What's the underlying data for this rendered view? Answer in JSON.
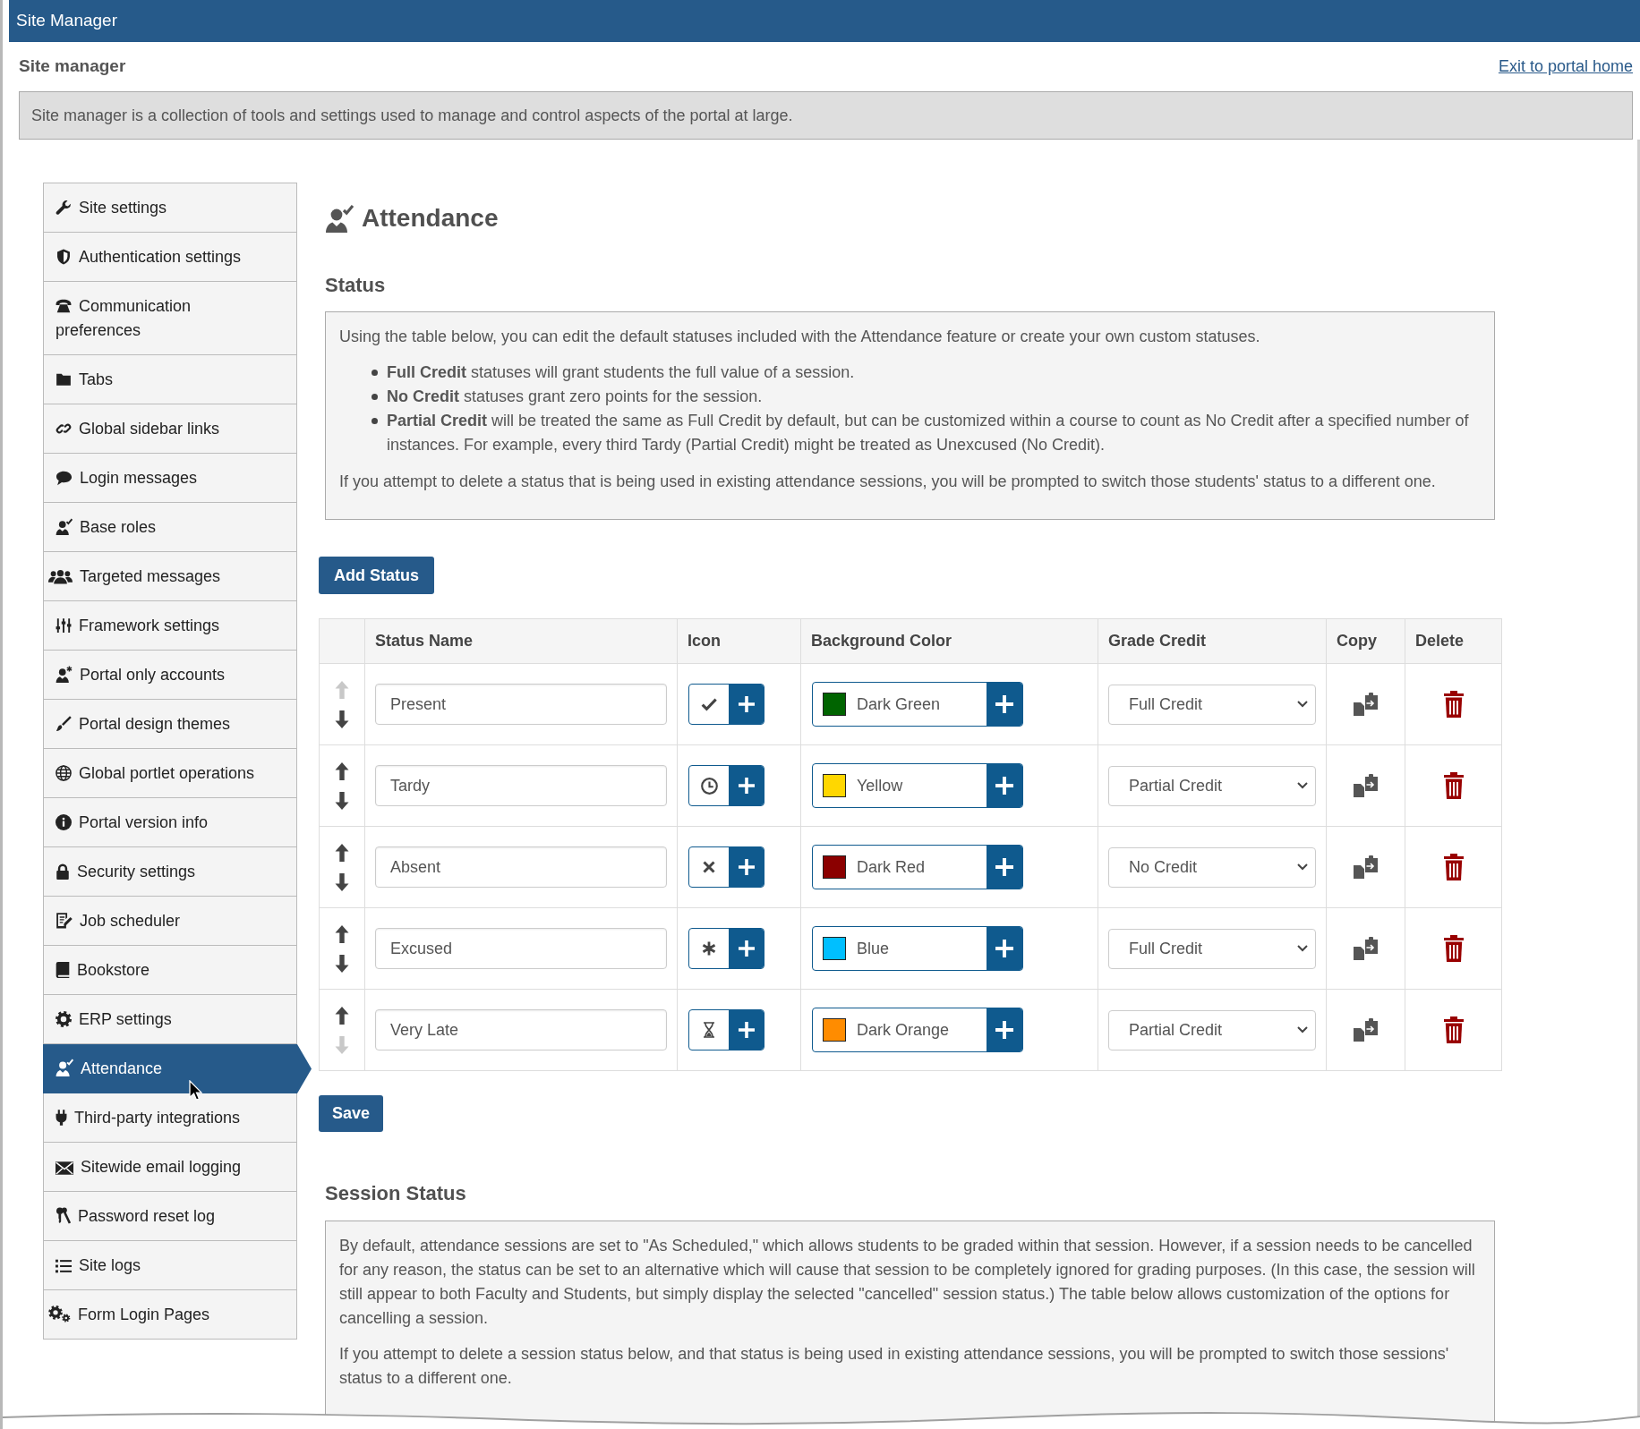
{
  "window": {
    "title": "Site Manager"
  },
  "header": {
    "title": "Site manager",
    "exit_link": "Exit to portal home",
    "description": "Site manager is a collection of tools and settings used to manage and control aspects of the portal at large."
  },
  "sidebar": {
    "items": [
      {
        "label": "Site settings",
        "selected": false
      },
      {
        "label": "Authentication settings",
        "selected": false
      },
      {
        "label": "Communication preferences",
        "selected": false
      },
      {
        "label": "Tabs",
        "selected": false
      },
      {
        "label": "Global sidebar links",
        "selected": false
      },
      {
        "label": "Login messages",
        "selected": false
      },
      {
        "label": "Base roles",
        "selected": false
      },
      {
        "label": "Targeted messages",
        "selected": false
      },
      {
        "label": "Framework settings",
        "selected": false
      },
      {
        "label": "Portal only accounts",
        "selected": false
      },
      {
        "label": "Portal design themes",
        "selected": false
      },
      {
        "label": "Global portlet operations",
        "selected": false
      },
      {
        "label": "Portal version info",
        "selected": false
      },
      {
        "label": "Security settings",
        "selected": false
      },
      {
        "label": "Job scheduler",
        "selected": false
      },
      {
        "label": "Bookstore",
        "selected": false
      },
      {
        "label": "ERP settings",
        "selected": false
      },
      {
        "label": "Attendance",
        "selected": true
      },
      {
        "label": "Third-party integrations",
        "selected": false
      },
      {
        "label": "Sitewide email logging",
        "selected": false
      },
      {
        "label": "Password reset log",
        "selected": false
      },
      {
        "label": "Site logs",
        "selected": false
      },
      {
        "label": "Form Login Pages",
        "selected": false
      }
    ]
  },
  "content": {
    "title": "Attendance",
    "status": {
      "heading": "Status",
      "intro": "Using the table below, you can edit the default statuses included with the Attendance feature or create your own custom statuses.",
      "bullets": [
        "**Full Credit** statuses will grant students the full value of a session.",
        "**No Credit** statuses grant zero points for the session.",
        "**Partial Credit** will be treated the same as Full Credit by default, but can be customized within a course to count as No Credit after a specified number of instances. For example, every third Tardy (Partial Credit) might be treated as Unexcused (No Credit)."
      ],
      "note": "If you attempt to delete a status that is being used in existing attendance sessions, you will be prompted to switch those students' status to a different one.",
      "add_button": "Add Status",
      "table": {
        "columns": [
          "Status Name",
          "Icon",
          "Background Color",
          "Grade Credit",
          "Copy",
          "Delete"
        ],
        "rows": [
          {
            "can_move_up": false,
            "can_move_down": true,
            "name": "Present",
            "color": "#006400",
            "color_name": "Dark Green",
            "grade_credit": "Full Credit"
          },
          {
            "can_move_up": true,
            "can_move_down": true,
            "name": "Tardy",
            "color": "#ffd700",
            "color_name": "Yellow",
            "grade_credit": "Partial Credit"
          },
          {
            "can_move_up": true,
            "can_move_down": true,
            "name": "Absent",
            "color": "#8b0000",
            "color_name": "Dark Red",
            "grade_credit": "No Credit"
          },
          {
            "can_move_up": true,
            "can_move_down": true,
            "name": "Excused",
            "color": "#00bfff",
            "color_name": "Blue",
            "grade_credit": "Full Credit"
          },
          {
            "can_move_up": true,
            "can_move_down": false,
            "name": "Very Late",
            "color": "#ff8c00",
            "color_name": "Dark Orange",
            "grade_credit": "Partial Credit"
          }
        ]
      },
      "save_button": "Save"
    },
    "session_status": {
      "heading": "Session Status",
      "paragraphs": [
        "By default, attendance sessions are set to \"As Scheduled,\" which allows students to be graded within that session. However, if a session needs to be cancelled for any reason, the status can be set to an alternative which will cause that session to be completely ignored for grading purposes. (In this case, the session will still appear to both Faculty and Students, but simply display the selected \"cancelled\" session status.) The table below allows customization of the options for cancelling a session.",
        "If you attempt to delete a session status below, and that status is being used in existing attendance sessions, you will be prompted to switch those sessions' status to a different one."
      ]
    }
  }
}
